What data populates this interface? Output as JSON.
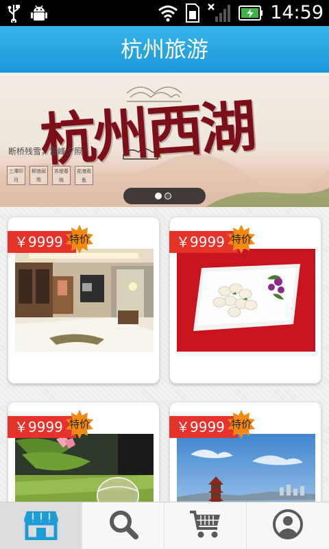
{
  "status_bar": {
    "time": "14:59",
    "icons": [
      "usb-icon",
      "android-debug-icon",
      "wifi-icon",
      "sim-icon",
      "no-signal-icon",
      "battery-charging-icon"
    ]
  },
  "header": {
    "title": "杭州旅游"
  },
  "banner": {
    "title": "杭州西湖",
    "subtitle": "断桥残雪，雷峰夕照",
    "tags": [
      "三潭印月",
      "柳浪闻莺",
      "苏堤春晓",
      "花港观鱼"
    ],
    "page_count": 2,
    "current_page": 1
  },
  "products": [
    {
      "price": "￥9999",
      "badge": "特价",
      "image": "hotel-room-photo"
    },
    {
      "price": "￥9999",
      "badge": "特价",
      "image": "shrimp-dish-photo"
    },
    {
      "price": "￥9999",
      "badge": "特价",
      "image": "green-tea-photo"
    },
    {
      "price": "￥9999",
      "badge": "特价",
      "image": "west-lake-photo"
    }
  ],
  "bottom_nav": {
    "items": [
      {
        "icon": "shop-icon",
        "active": true
      },
      {
        "icon": "search-icon",
        "active": false
      },
      {
        "icon": "cart-icon",
        "active": false
      },
      {
        "icon": "user-icon",
        "active": false
      }
    ]
  },
  "colors": {
    "header_blue": "#1c98d8",
    "price_red": "#e5322b",
    "badge_orange": "#f28a12",
    "nav_active_blue": "#1e9cd8"
  }
}
